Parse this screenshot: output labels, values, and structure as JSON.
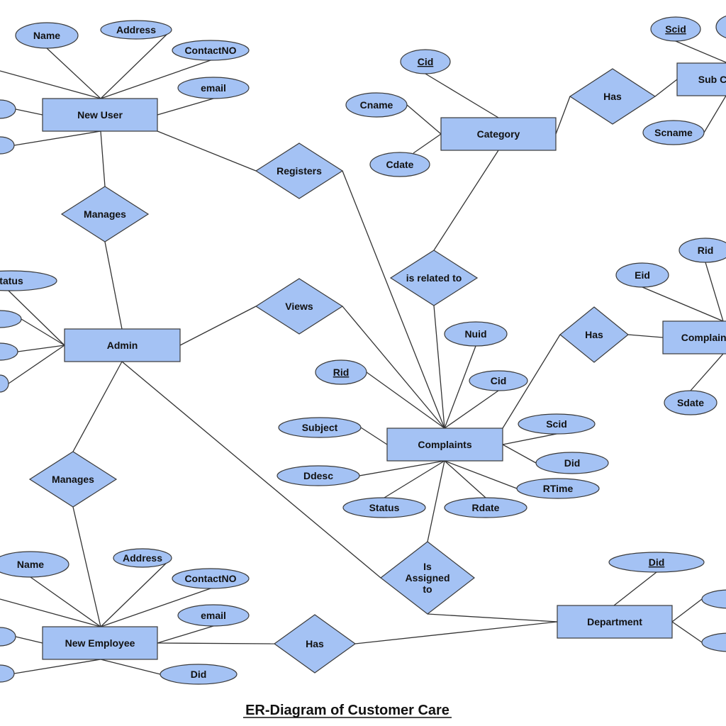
{
  "title": "ER-Diagram of Customer Care",
  "entities": [
    {
      "id": "new-user",
      "label": "New User"
    },
    {
      "id": "admin",
      "label": "Admin"
    },
    {
      "id": "new-employee",
      "label": "New Employee"
    },
    {
      "id": "category",
      "label": "Category"
    },
    {
      "id": "sub-category",
      "label": "Sub C"
    },
    {
      "id": "complaints",
      "label": "Complaints"
    },
    {
      "id": "complaint-status",
      "label": "Complaint"
    },
    {
      "id": "department",
      "label": "Department"
    }
  ],
  "relationships": [
    {
      "id": "manages-user",
      "label": "Manages"
    },
    {
      "id": "registers",
      "label": "Registers"
    },
    {
      "id": "has-subcategory",
      "label": "Has"
    },
    {
      "id": "is-related-to",
      "label": "is related to"
    },
    {
      "id": "views",
      "label": "Views"
    },
    {
      "id": "has-status",
      "label": "Has"
    },
    {
      "id": "manages-employee",
      "label": "Manages"
    },
    {
      "id": "is-assigned-to",
      "label": [
        "Is",
        "Assigned",
        "to"
      ]
    },
    {
      "id": "has-department",
      "label": "Has"
    }
  ],
  "attributes": [
    {
      "id": "nu-name",
      "label": "Name",
      "key": false
    },
    {
      "id": "nu-address",
      "label": "Address",
      "key": false
    },
    {
      "id": "nu-contact",
      "label": "ContactNO",
      "key": false
    },
    {
      "id": "nu-email",
      "label": "email",
      "key": false
    },
    {
      "id": "nu-left1",
      "label": "",
      "key": false
    },
    {
      "id": "nu-left2",
      "label": "",
      "key": false
    },
    {
      "id": "cat-cid",
      "label": "Cid",
      "key": true
    },
    {
      "id": "cat-cname",
      "label": "Cname",
      "key": false
    },
    {
      "id": "cat-cdate",
      "label": "Cdate",
      "key": false
    },
    {
      "id": "sc-scid",
      "label": "Scid",
      "key": true
    },
    {
      "id": "sc-right",
      "label": "",
      "key": false
    },
    {
      "id": "sc-scname",
      "label": "Scname",
      "key": false
    },
    {
      "id": "ad-status",
      "label": "tatus",
      "key": false
    },
    {
      "id": "ad-left1",
      "label": "",
      "key": false
    },
    {
      "id": "ad-left2",
      "label": "",
      "key": false
    },
    {
      "id": "ad-left3",
      "label": "",
      "key": false
    },
    {
      "id": "cs-eid",
      "label": "Eid",
      "key": false
    },
    {
      "id": "cs-rid",
      "label": "Rid",
      "key": false
    },
    {
      "id": "cs-sdate",
      "label": "Sdate",
      "key": false
    },
    {
      "id": "c-nuid",
      "label": "Nuid",
      "key": false
    },
    {
      "id": "c-rid",
      "label": "Rid",
      "key": true
    },
    {
      "id": "c-cid",
      "label": "Cid",
      "key": false
    },
    {
      "id": "c-subject",
      "label": "Subject",
      "key": false
    },
    {
      "id": "c-scid",
      "label": "Scid",
      "key": false
    },
    {
      "id": "c-did",
      "label": "Did",
      "key": false
    },
    {
      "id": "c-ddesc",
      "label": "Ddesc",
      "key": false
    },
    {
      "id": "c-rtime",
      "label": "RTime",
      "key": false
    },
    {
      "id": "c-status",
      "label": "Status",
      "key": false
    },
    {
      "id": "c-rdate",
      "label": "Rdate",
      "key": false
    },
    {
      "id": "ne-name",
      "label": "Name",
      "key": false
    },
    {
      "id": "ne-address",
      "label": "Address",
      "key": false
    },
    {
      "id": "ne-contact",
      "label": "ContactNO",
      "key": false
    },
    {
      "id": "ne-email",
      "label": "email",
      "key": false
    },
    {
      "id": "ne-did",
      "label": "Did",
      "key": false
    },
    {
      "id": "ne-left1",
      "label": "",
      "key": false
    },
    {
      "id": "ne-left2",
      "label": "",
      "key": false
    },
    {
      "id": "d-did",
      "label": "Did",
      "key": true
    },
    {
      "id": "d-right1",
      "label": "",
      "key": false
    },
    {
      "id": "d-right2",
      "label": "",
      "key": false
    }
  ],
  "connections": [
    [
      "nu-name",
      "new-user"
    ],
    [
      "nu-address",
      "new-user"
    ],
    [
      "nu-contact",
      "new-user"
    ],
    [
      "nu-email",
      "new-user"
    ],
    [
      "nu-left1",
      "new-user"
    ],
    [
      "nu-left2",
      "new-user"
    ],
    [
      "nu-offleft",
      "new-user"
    ],
    [
      "new-user",
      "manages-user"
    ],
    [
      "manages-user",
      "admin"
    ],
    [
      "new-user",
      "registers"
    ],
    [
      "registers",
      "complaints"
    ],
    [
      "cat-cid",
      "category"
    ],
    [
      "cat-cname",
      "category"
    ],
    [
      "cat-cdate",
      "category"
    ],
    [
      "category",
      "has-subcategory"
    ],
    [
      "has-subcategory",
      "sub-category"
    ],
    [
      "sc-scid",
      "sub-category"
    ],
    [
      "sc-scname",
      "sub-category"
    ],
    [
      "sc-right",
      "sub-category"
    ],
    [
      "category",
      "is-related-to"
    ],
    [
      "is-related-to",
      "complaints"
    ],
    [
      "ad-status",
      "admin"
    ],
    [
      "ad-left1",
      "admin"
    ],
    [
      "ad-left2",
      "admin"
    ],
    [
      "ad-left3",
      "admin"
    ],
    [
      "admin",
      "views"
    ],
    [
      "views",
      "complaints"
    ],
    [
      "admin",
      "manages-employee"
    ],
    [
      "manages-employee",
      "new-employee"
    ],
    [
      "admin",
      "department"
    ],
    [
      "c-nuid",
      "complaints"
    ],
    [
      "c-rid",
      "complaints"
    ],
    [
      "c-cid",
      "complaints"
    ],
    [
      "c-subject",
      "complaints"
    ],
    [
      "c-scid",
      "complaints"
    ],
    [
      "c-did",
      "complaints"
    ],
    [
      "c-ddesc",
      "complaints"
    ],
    [
      "c-rtime",
      "complaints"
    ],
    [
      "c-status",
      "complaints"
    ],
    [
      "c-rdate",
      "complaints"
    ],
    [
      "complaints",
      "has-status"
    ],
    [
      "has-status",
      "complaint-status"
    ],
    [
      "cs-eid",
      "complaint-status"
    ],
    [
      "cs-rid",
      "complaint-status"
    ],
    [
      "cs-sdate",
      "complaint-status"
    ],
    [
      "complaints",
      "is-assigned-to"
    ],
    [
      "is-assigned-to",
      "department"
    ],
    [
      "ne-name",
      "new-employee"
    ],
    [
      "ne-address",
      "new-employee"
    ],
    [
      "ne-contact",
      "new-employee"
    ],
    [
      "ne-email",
      "new-employee"
    ],
    [
      "ne-did",
      "new-employee"
    ],
    [
      "ne-left1",
      "new-employee"
    ],
    [
      "ne-left2",
      "new-employee"
    ],
    [
      "ne-offleft",
      "new-employee"
    ],
    [
      "new-employee",
      "has-department"
    ],
    [
      "has-department",
      "department"
    ],
    [
      "d-did",
      "department"
    ],
    [
      "d-right1",
      "department"
    ],
    [
      "d-right2",
      "department"
    ]
  ]
}
